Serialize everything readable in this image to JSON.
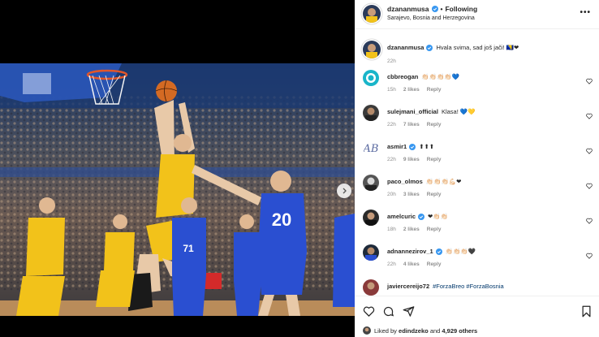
{
  "post": {
    "author": "dzananmusa",
    "follow_status": "Following",
    "location": "Sarajevo, Bosnia and Herzegovina",
    "more_label": "•••",
    "separator": "•"
  },
  "caption": {
    "username": "dzananmusa",
    "text": "Hvala svima, sad još jači! 🇧🇦❤",
    "time": "22h"
  },
  "comments": [
    {
      "username": "cbbreogan",
      "text": "👏🏻👏🏻👏🏻👏🏻💙",
      "time": "15h",
      "likes": "2 likes",
      "reply": "Reply",
      "verified": false
    },
    {
      "username": "sulejmani_official",
      "text": "Klasa! 💙💛",
      "time": "22h",
      "likes": "7 likes",
      "reply": "Reply",
      "verified": false
    },
    {
      "username": "asmir1",
      "text": "⬆⬆⬆",
      "time": "22h",
      "likes": "9 likes",
      "reply": "Reply",
      "verified": true
    },
    {
      "username": "paco_olmos",
      "text": "👏🏻👏🏻👏🏻💪🏻❤",
      "time": "20h",
      "likes": "3 likes",
      "reply": "Reply",
      "verified": false
    },
    {
      "username": "amelcuric",
      "text": "❤👏🏻👏🏻",
      "time": "18h",
      "likes": "2 likes",
      "reply": "Reply",
      "verified": true
    },
    {
      "username": "adnannezirov_1",
      "text": "👏🏻👏🏻👏🏻🖤",
      "time": "22h",
      "likes": "4 likes",
      "reply": "Reply",
      "verified": true
    },
    {
      "username": "javiercereijo72",
      "text": "#ForzaBreo #ForzaBosnia",
      "time": "",
      "likes": "",
      "reply": "",
      "verified": false
    }
  ],
  "footer": {
    "liked_prefix": "Liked by",
    "liked_user": "edindzeko",
    "liked_and": "and",
    "liked_count": "4,929 others"
  },
  "icons": {
    "like": "heart-icon",
    "comment": "comment-icon",
    "share": "share-icon",
    "save": "bookmark-icon",
    "verified": "verified-badge-icon",
    "next": "chevron-right-icon"
  },
  "colors": {
    "verified": "#3897f0",
    "link": "#00376b",
    "muted": "#8e8e8e",
    "jersey_home": "#f2c21a",
    "jersey_away": "#2a4fd1"
  }
}
